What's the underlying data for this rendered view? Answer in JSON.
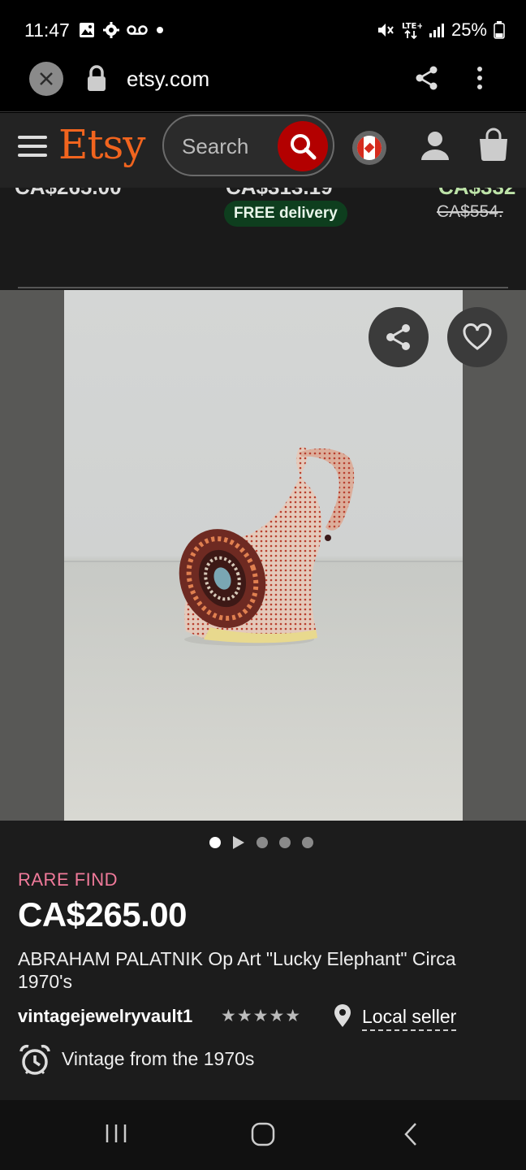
{
  "status_bar": {
    "time": "11:47",
    "battery": "25%",
    "icons": [
      "image-icon",
      "gear-icon",
      "voicemail-icon",
      "dot-icon",
      "mute-icon",
      "lte-icon",
      "signal-icon",
      "battery-icon"
    ]
  },
  "browser": {
    "url": "etsy.com"
  },
  "header": {
    "logo": "Etsy",
    "search_placeholder": "Search"
  },
  "recommendations": {
    "free_delivery": "FREE delivery",
    "strike_price": "CA$554."
  },
  "listing": {
    "badge": "RARE FIND",
    "price": "CA$265.00",
    "title": "ABRAHAM PALATNIK Op Art \"Lucky Elephant\" Circa 1970's",
    "seller": "vintagejewelryvault1",
    "rating_stars": "★★★★★",
    "rating_value": 5,
    "local_seller": "Local seller",
    "vintage_note": "Vintage from the 1970s"
  },
  "gallery": {
    "image_count": 5,
    "active_index": 0,
    "has_video": true
  },
  "colors": {
    "etsy_orange": "#f1641e",
    "rare_pink": "#f07a9a",
    "search_red": "#b30000",
    "free_green_bg": "#0e3e1e"
  }
}
